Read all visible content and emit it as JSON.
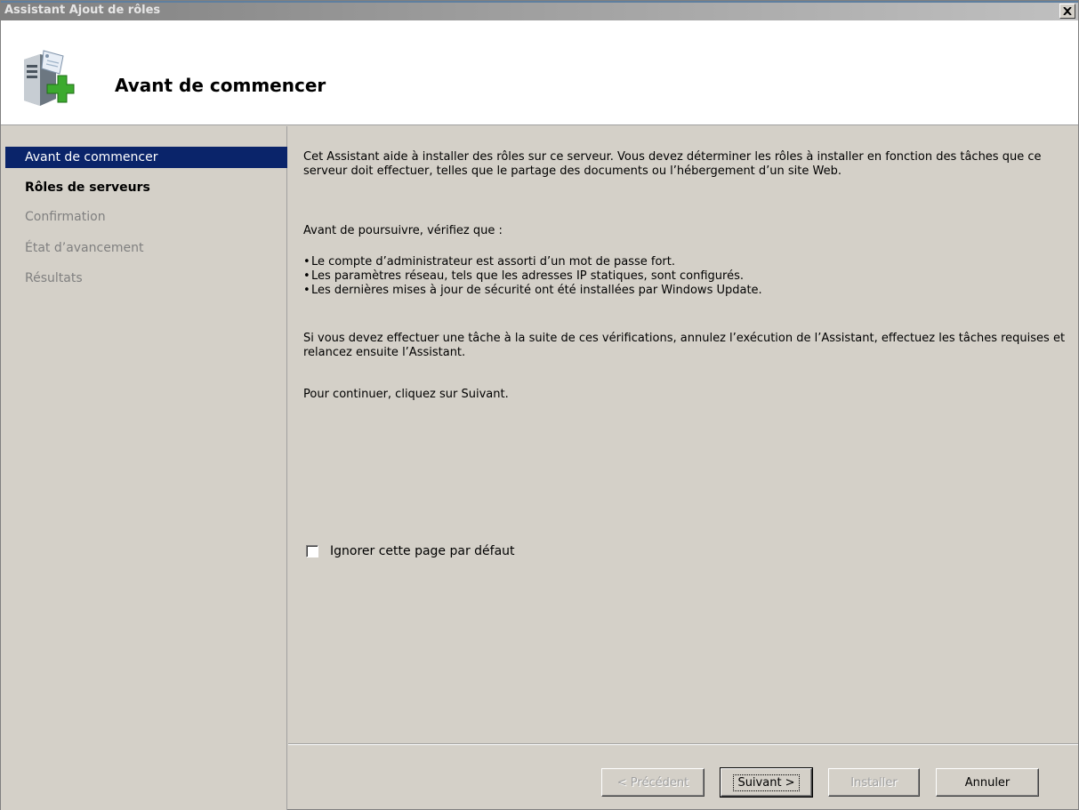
{
  "window": {
    "title": "Assistant Ajout de rôles",
    "close_label": "×"
  },
  "header": {
    "title": "Avant de commencer",
    "icon": "server-roles-add-icon"
  },
  "sidebar": {
    "items": [
      {
        "label": "Avant de commencer",
        "state": "active"
      },
      {
        "label": "Rôles de serveurs",
        "state": "bold"
      },
      {
        "label": "Confirmation",
        "state": "disabled"
      },
      {
        "label": "État d’avancement",
        "state": "disabled"
      },
      {
        "label": "Résultats",
        "state": "disabled"
      }
    ]
  },
  "content": {
    "intro": "Cet Assistant aide à installer des rôles sur ce serveur. Vous devez déterminer les rôles à installer en fonction des tâches que ce serveur doit effectuer, telles que le partage des documents ou l’hébergement d’un site Web.",
    "before_continue": "Avant de poursuivre, vérifiez que :",
    "checks": [
      "Le compte d’administrateur est assorti d’un mot de passe fort.",
      "Les paramètres réseau, tels que les adresses IP statiques, sont configurés.",
      "Les dernières mises à jour de sécurité ont été installées par Windows Update."
    ],
    "cancel_note": "Si vous devez effectuer une tâche à la suite de ces vérifications, annulez l’exécution de l’Assistant, effectuez les tâches requises et relancez ensuite l’Assistant.",
    "continue_note": "Pour continuer, cliquez sur Suivant.",
    "skip_checkbox_label": "Ignorer cette page par défaut",
    "skip_checked": false
  },
  "footer": {
    "prev_label": "< Précédent",
    "next_label": "Suivant >",
    "install_label": "Installer",
    "cancel_label": "Annuler"
  }
}
